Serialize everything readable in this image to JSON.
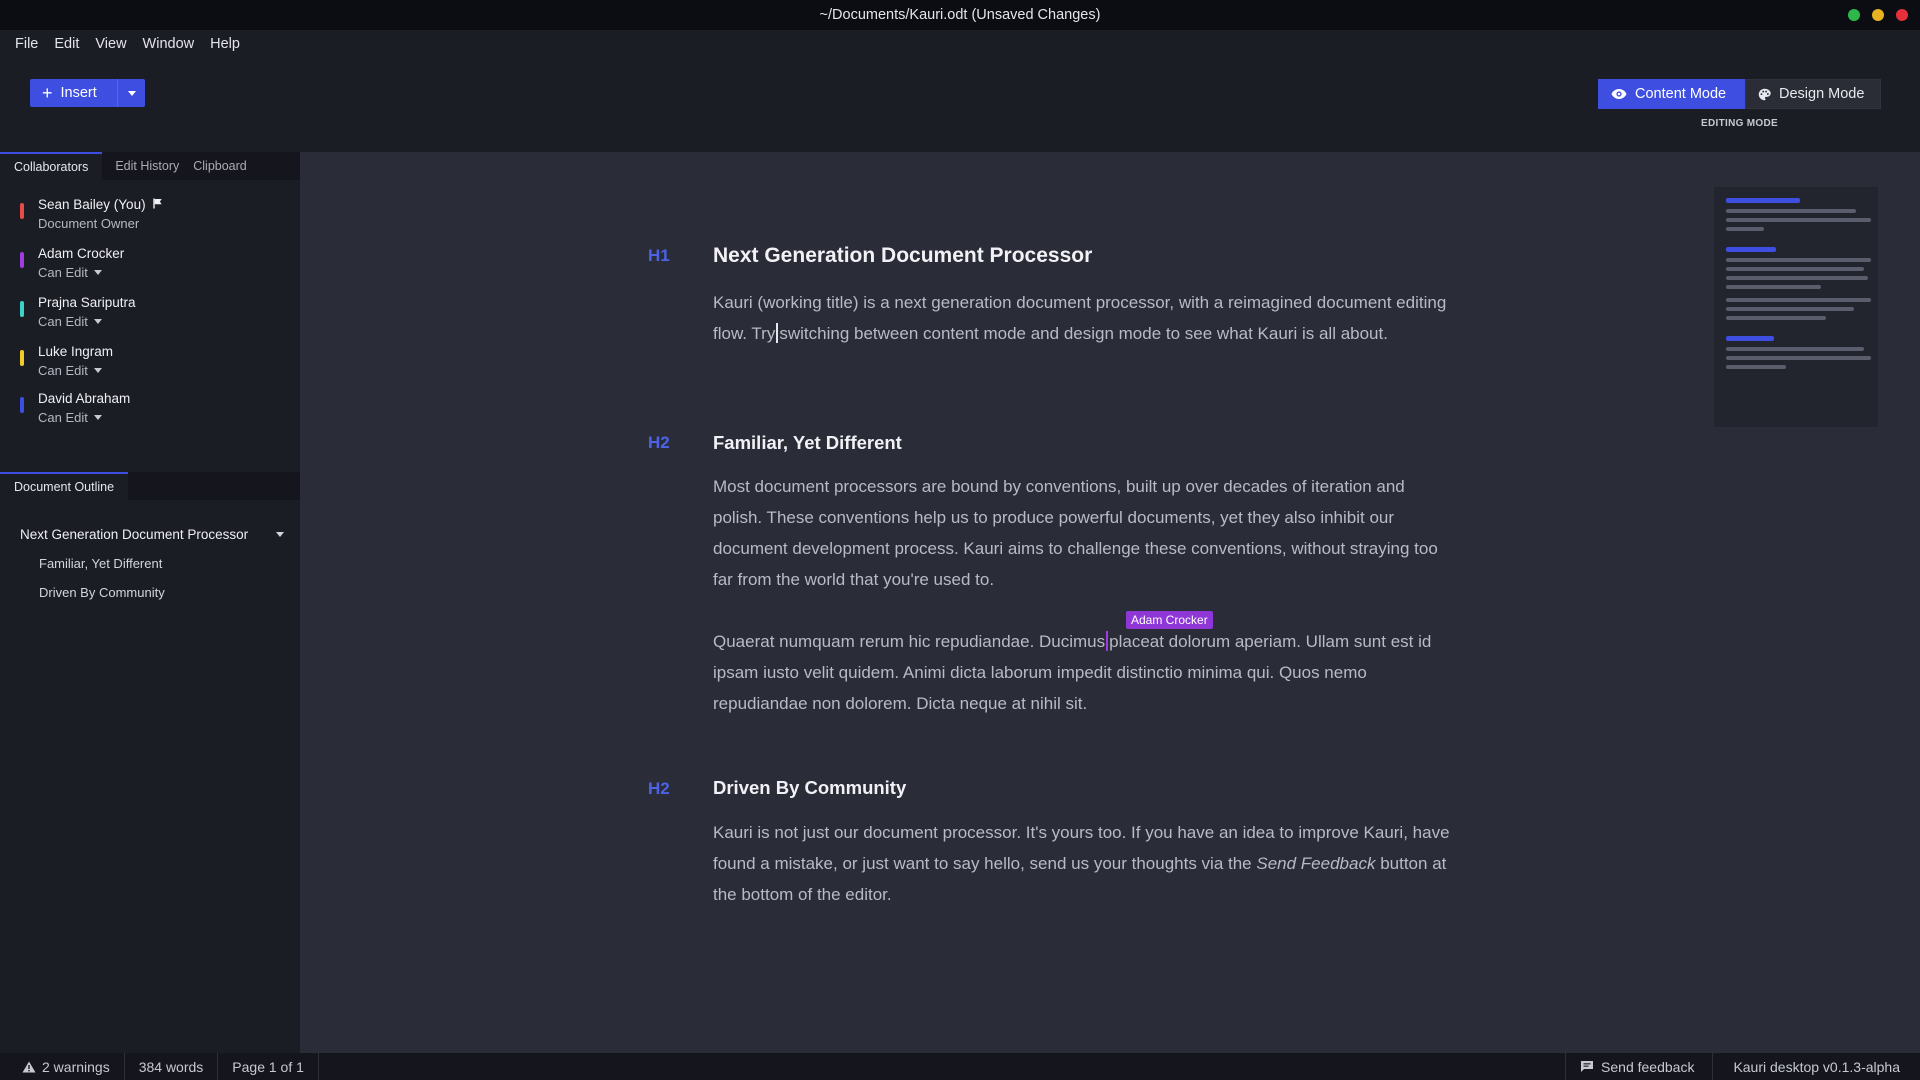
{
  "window": {
    "title": "~/Documents/Kauri.odt (Unsaved Changes)",
    "controls": [
      {
        "name": "maximize",
        "color": "#2eb84b"
      },
      {
        "name": "minimize",
        "color": "#e8b220"
      },
      {
        "name": "close",
        "color": "#e8303a"
      }
    ]
  },
  "menu": [
    "File",
    "Edit",
    "View",
    "Window",
    "Help"
  ],
  "toolbar": {
    "insert_label": "Insert",
    "content_mode_label": "Content Mode",
    "design_mode_label": "Design Mode",
    "editing_mode_label": "EDITING MODE",
    "accent": "#3d4ee0"
  },
  "sidebar": {
    "tabs": [
      "Collaborators",
      "Edit History",
      "Clipboard"
    ],
    "collaborators": [
      {
        "name": "Sean Bailey (You)",
        "role": "Document Owner",
        "color": "#e84a4a",
        "owner": true
      },
      {
        "name": "Adam Crocker",
        "role": "Can Edit",
        "color": "#a03de0"
      },
      {
        "name": "Prajna Sariputra",
        "role": "Can Edit",
        "color": "#3fd0c8"
      },
      {
        "name": "Luke Ingram",
        "role": "Can Edit",
        "color": "#f0cc2a"
      },
      {
        "name": "David Abraham",
        "role": "Can Edit",
        "color": "#3d4ee0"
      }
    ],
    "outline_tab": "Document Outline",
    "outline": [
      {
        "level": "h1",
        "label": "Next Generation Document Processor"
      },
      {
        "level": "h2",
        "label": "Familiar, Yet Different"
      },
      {
        "level": "h2",
        "label": "Driven By Community"
      }
    ]
  },
  "document": {
    "section1": {
      "mark": "H1",
      "heading": "Next Generation Document Processor",
      "para_before_caret": "Kauri (working title) is a next generation document processor, with a reimagined document editing flow. Try",
      "para_after_caret": "switching between content mode and design mode to see what Kauri is all about."
    },
    "section2": {
      "mark": "H2",
      "heading": "Familiar, Yet Different",
      "para1": "Most document processors are bound by conventions, built up over decades of iteration and polish. These conventions help us to produce powerful documents, yet they also inhibit our document development process. Kauri aims to challenge these conventions, without straying too far from the world that you're used to.",
      "para2_before_caret": "Quaerat numquam rerum hic repudiandae. Ducimus",
      "para2_after_caret": "placeat dolorum aperiam. Ullam sunt est id ipsam iusto velit quidem. Animi dicta laborum impedit distinctio minima qui. Quos nemo repudiandae non dolorem. Dicta neque at nihil sit.",
      "peer_cursor_label": "Adam Crocker"
    },
    "section3": {
      "mark": "H2",
      "heading": "Driven By Community",
      "para_part1": "Kauri is not just our document processor. It's yours too. If you have an idea to improve Kauri, have found a mistake, or just want to say hello, send us your thoughts via the",
      "para_italic": "Send Feedback",
      "para_part2": "button at the bottom of the editor."
    }
  },
  "status": {
    "warnings": "2 warnings",
    "words": "384 words",
    "page": "Page 1 of 1",
    "feedback": "Send feedback",
    "version": "Kauri desktop v0.1.3-alpha"
  }
}
